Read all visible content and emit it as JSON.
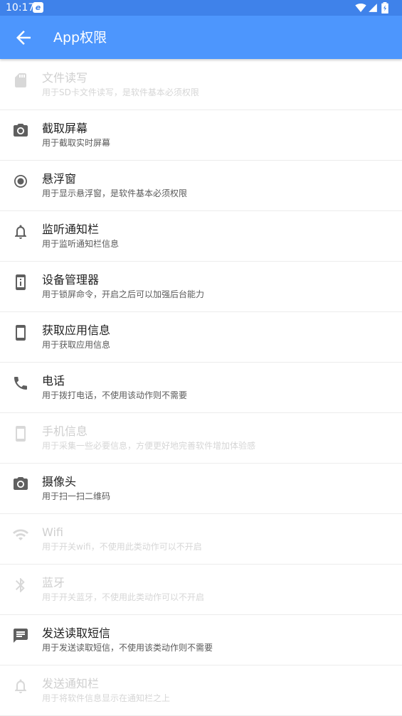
{
  "status_bar": {
    "time": "10:17",
    "app_icon": "e",
    "icons": [
      "wifi-icon",
      "signal-icon",
      "battery-icon"
    ]
  },
  "app_bar": {
    "title": "App权限",
    "back_icon": "arrow-back-icon"
  },
  "colors": {
    "status_bar": "#3f82ea",
    "app_bar": "#4d96fd",
    "icon_enabled": "#5f5f5f",
    "icon_disabled": "#d8d8d8"
  },
  "permissions": [
    {
      "title": "文件读写",
      "desc": "用于SD卡文件读写，是软件基本必须权限",
      "icon": "sd-card-icon",
      "enabled": false
    },
    {
      "title": "截取屏幕",
      "desc": "用于截取实时屏幕",
      "icon": "camera-icon",
      "enabled": true
    },
    {
      "title": "悬浮窗",
      "desc": "用于显示悬浮窗，是软件基本必须权限",
      "icon": "radio-button-icon",
      "enabled": true
    },
    {
      "title": "监听通知栏",
      "desc": "用于监听通知栏信息",
      "icon": "bell-icon",
      "enabled": true
    },
    {
      "title": "设备管理器",
      "desc": "用于锁屏命令，开启之后可以加强后台能力",
      "icon": "device-info-icon",
      "enabled": true
    },
    {
      "title": "获取应用信息",
      "desc": "用于获取应用信息",
      "icon": "phone-device-icon",
      "enabled": true
    },
    {
      "title": "电话",
      "desc": "用于拨打电话，不使用该动作则不需要",
      "icon": "phone-call-icon",
      "enabled": true
    },
    {
      "title": "手机信息",
      "desc": "用于采集一些必要信息，方便更好地完善软件增加体验感",
      "icon": "phone-device-icon",
      "enabled": false
    },
    {
      "title": "摄像头",
      "desc": "用于扫一扫二维码",
      "icon": "camera-icon",
      "enabled": true
    },
    {
      "title": "Wifi",
      "desc": "用于开关wifi，不使用此类动作可以不开启",
      "icon": "wifi-icon",
      "enabled": false
    },
    {
      "title": "蓝牙",
      "desc": "用于开关蓝牙，不使用此类动作可以不开启",
      "icon": "bluetooth-icon",
      "enabled": false
    },
    {
      "title": "发送读取短信",
      "desc": "用于发送读取短信，不使用该类动作则不需要",
      "icon": "message-icon",
      "enabled": true
    },
    {
      "title": "发送通知栏",
      "desc": "用于将软件信息显示在通知栏之上",
      "icon": "bell-icon",
      "enabled": false
    }
  ]
}
